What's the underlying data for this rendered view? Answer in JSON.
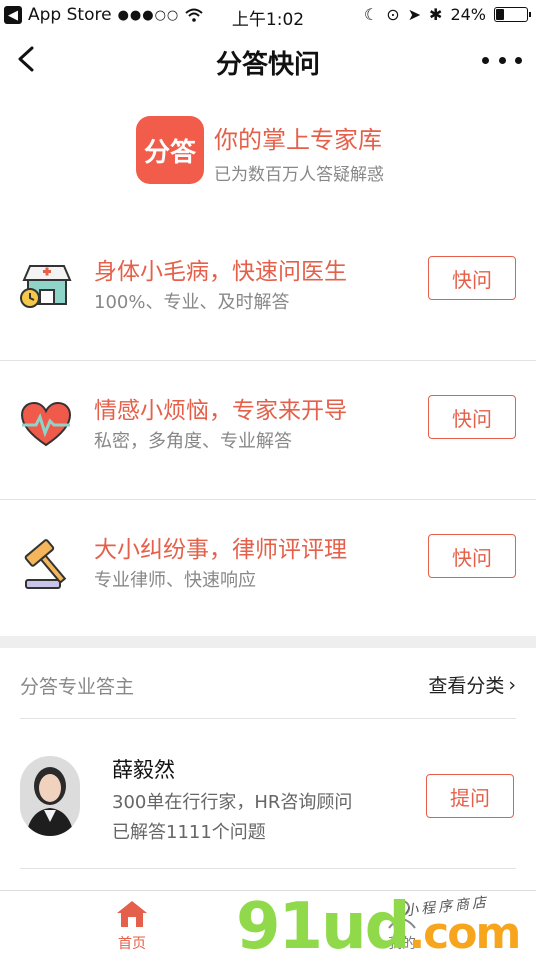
{
  "status_bar": {
    "back_app": "App Store",
    "signal": "●●●○○",
    "time": "上午1:02",
    "battery": "24%",
    "battery_level": 0.24
  },
  "nav": {
    "title": "分答快问"
  },
  "hero": {
    "logo_text": "分答",
    "slogan": "你的掌上专家库",
    "subtitle": "已为数百万人答疑解惑"
  },
  "services": [
    {
      "title": "身体小毛病，快速问医生",
      "desc": "100%、专业、及时解答",
      "button": "快问",
      "icon": "clinic-icon"
    },
    {
      "title": "情感小烦恼，专家来开导",
      "desc": "私密，多角度、专业解答",
      "button": "快问",
      "icon": "heart-pulse-icon"
    },
    {
      "title": "大小纠纷事，律师评评理",
      "desc": "专业律师、快速响应",
      "button": "快问",
      "icon": "gavel-icon"
    }
  ],
  "experts_section": {
    "label": "分答专业答主",
    "link": "查看分类",
    "experts": [
      {
        "name": "薛毅然",
        "line1": "300单在行行家，HR咨询顾问",
        "line2": "已解答1111个问题",
        "button": "提问"
      }
    ]
  },
  "tabbar": {
    "home": "首页",
    "mine": "我的"
  },
  "watermark": {
    "main": "91ud",
    "suffix": ".com",
    "sub": "小程序商店"
  },
  "colors": {
    "accent": "#e5604a",
    "logo_bg": "#f15c4b",
    "watermark_green": "#8fd94a",
    "watermark_orange": "#f6a51d"
  }
}
